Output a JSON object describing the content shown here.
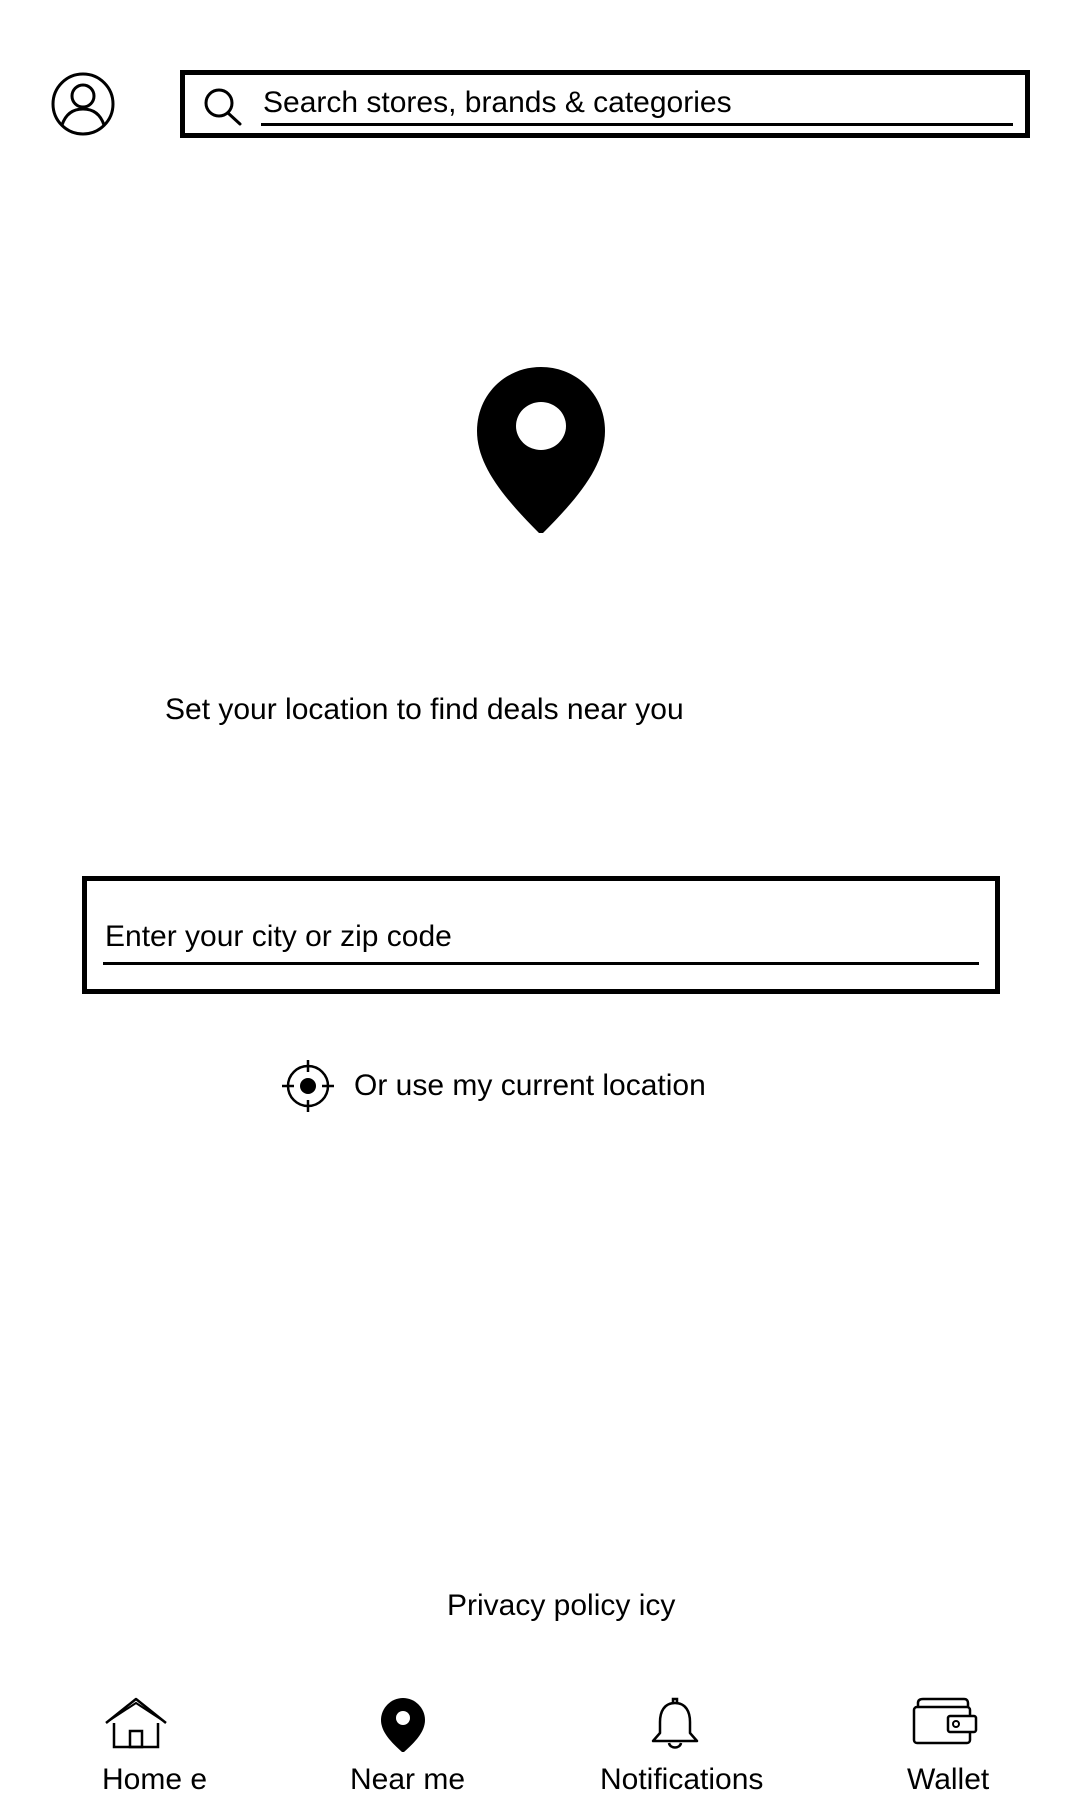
{
  "header": {
    "profile_icon": "user-circle-icon",
    "search": {
      "icon": "search-icon",
      "placeholder": "Search stores, brands & categories",
      "value": ""
    }
  },
  "main": {
    "hero_icon": "location-pin-icon",
    "prompt": "Set your location to find deals near you",
    "location_input": {
      "placeholder": "Enter your city or zip code",
      "value": ""
    },
    "current_location": {
      "icon": "crosshair-icon",
      "label": "Or use my current location"
    }
  },
  "footer": {
    "privacy_link": "Privacy policy icy"
  },
  "bottom_nav": {
    "items": [
      {
        "icon": "home-icon",
        "label": "Home e"
      },
      {
        "icon": "location-pin-icon",
        "label": "Near me"
      },
      {
        "icon": "bell-icon",
        "label": "Notifications"
      },
      {
        "icon": "wallet-icon",
        "label": "Wallet"
      }
    ]
  },
  "colors": {
    "foreground": "#000000",
    "background": "#ffffff"
  }
}
